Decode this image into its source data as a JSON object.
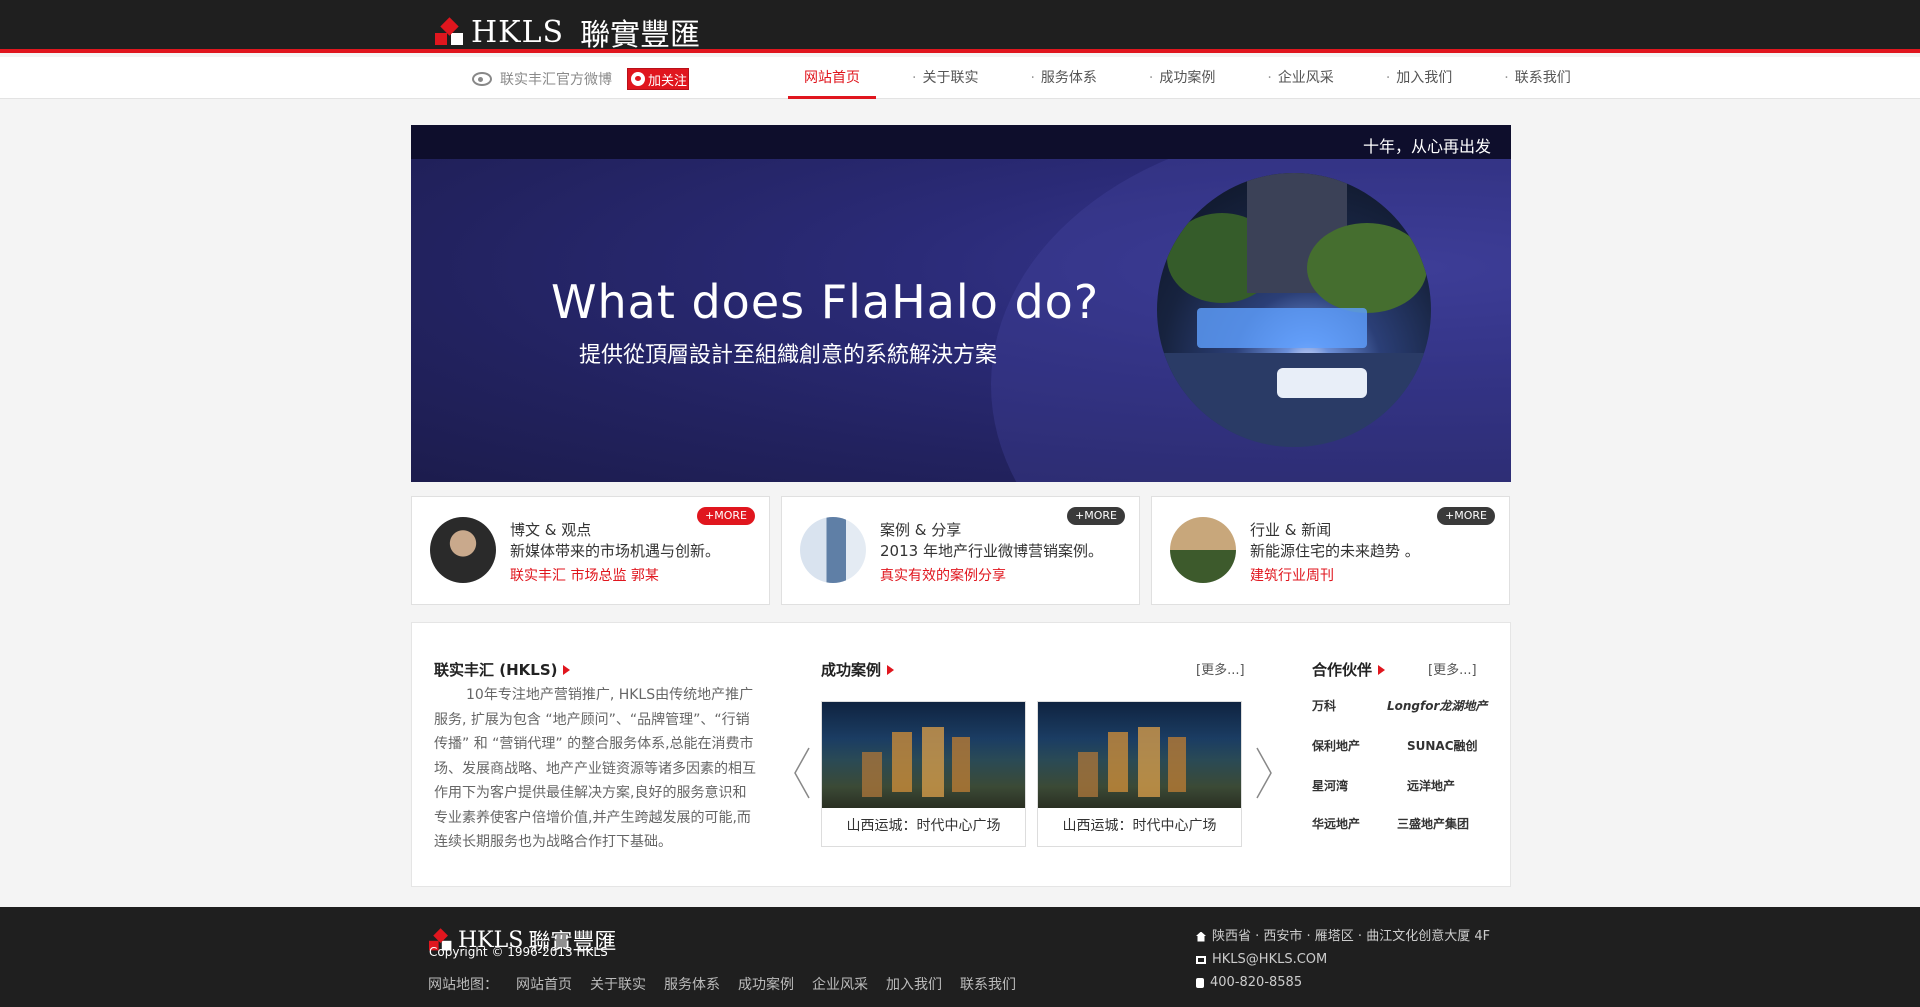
{
  "header": {
    "logo_en": "HKLS",
    "logo_cn": "聯實豐匯"
  },
  "navbar": {
    "weibo_text": "联实丰汇官方微博",
    "follow_label": "加关注",
    "items": [
      {
        "label": "网站首页",
        "active": true
      },
      {
        "label": "关于联实"
      },
      {
        "label": "服务体系"
      },
      {
        "label": "成功案例"
      },
      {
        "label": "企业风采"
      },
      {
        "label": "加入我们"
      },
      {
        "label": "联系我们"
      }
    ]
  },
  "banner": {
    "slogan": "十年，从心再出发",
    "title": "What does FlaHalo do?",
    "subtitle": "提供從頂層設計至組織創意的系統解決方案"
  },
  "cards": [
    {
      "title": "博文 & 观点",
      "desc": "新媒体带来的市场机遇与创新。",
      "link": "联实丰汇 市场总监 郭某",
      "more": "+MORE"
    },
    {
      "title": "案例 & 分享",
      "desc": "2013 年地产行业微博营销案例。",
      "link": "真实有效的案例分享",
      "more": "+MORE"
    },
    {
      "title": "行业 & 新闻",
      "desc": "新能源住宅的未来趋势 。",
      "link": "建筑行业周刊",
      "more": "+MORE"
    }
  ],
  "about": {
    "title": "联实丰汇 (HKLS)",
    "text": "10年专注地产营销推广, HKLS由传统地产推广服务, 扩展为包含 “地产顾问”、“品牌管理”、“行销传播” 和 “营销代理” 的整合服务体系,总能在消费市场、发展商战略、地产产业链资源等诸多因素的相互作用下为客户提供最佳解决方案,良好的服务意识和专业素养使客户倍增价值,并产生跨越发展的可能,而连续长期服务也为战略合作打下基础。"
  },
  "cases": {
    "title": "成功案例",
    "more": "[更多...]",
    "items": [
      {
        "caption": "山西运城：时代中心广场"
      },
      {
        "caption": "山西运城：时代中心广场"
      }
    ]
  },
  "partners": {
    "title": "合作伙伴",
    "more": "[更多...]",
    "logos": [
      "万科",
      "Longfor龙湖地产",
      "保利地产",
      "SUNAC融创",
      "星河湾",
      "远洋地产",
      "华远地产",
      "三盛地产集团"
    ]
  },
  "footer": {
    "logo_en": "HKLS",
    "logo_cn": "聯實豐匯",
    "copyright": "Copyright © 1996-2013 HKLS",
    "sitemap_label": "网站地图：",
    "links": [
      "网站首页",
      "关于联实",
      "服务体系",
      "成功案例",
      "企业风采",
      "加入我们",
      "联系我们"
    ],
    "address": "陕西省 · 西安市 · 雁塔区 · 曲江文化创意大厦 4F",
    "email": "HKLS@HKLS.COM",
    "phone": "400-820-8585"
  },
  "colors": {
    "accent": "#e0161e",
    "header_bg": "#1f1f1f",
    "banner_bg": "#2b2b78"
  }
}
